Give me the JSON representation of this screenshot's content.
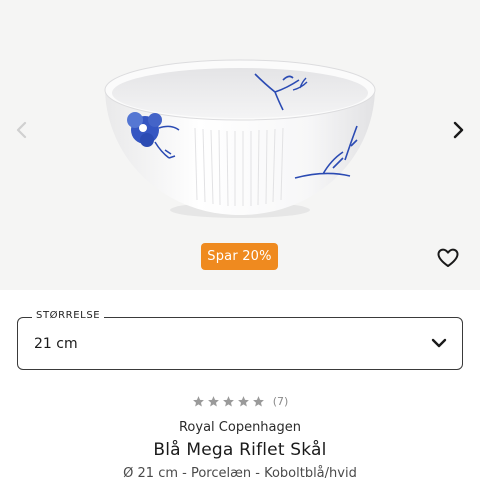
{
  "gallery": {
    "image_alt": "Blå Mega Riflet Skål",
    "prev_icon": "chevron-left-icon",
    "next_icon": "chevron-right-icon"
  },
  "badge": {
    "label": "Spar 20%",
    "color": "#ef8a1f"
  },
  "favorite": {
    "icon": "heart-outline-icon"
  },
  "size_select": {
    "label": "STØRRELSE",
    "value": "21 cm",
    "icon": "chevron-down-icon"
  },
  "rating": {
    "stars": 0,
    "max_stars": 5,
    "count": "(7)"
  },
  "product": {
    "brand": "Royal Copenhagen",
    "title": "Blå Mega Riflet Skål",
    "subtitle": "Ø 21 cm - Porcelæn - Koboltblå/hvid"
  },
  "colors": {
    "accent": "#ef8a1f",
    "star_empty": "#9a9a9a",
    "cobalt": "#2b4bb3"
  }
}
